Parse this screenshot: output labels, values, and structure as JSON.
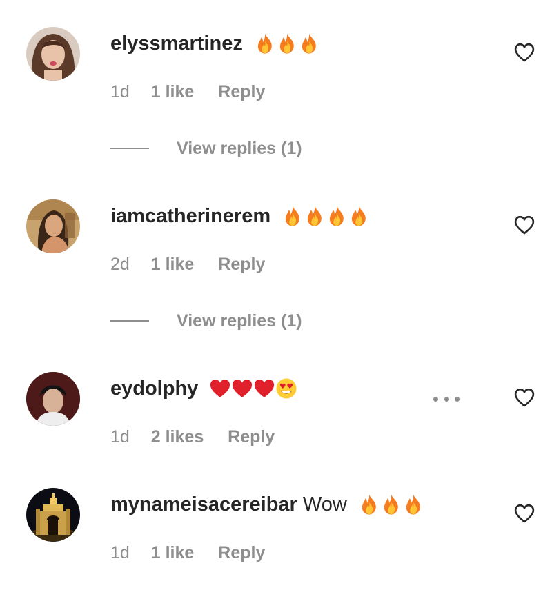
{
  "comments": [
    {
      "username": "elyssmartinez",
      "text": "",
      "emoji": [
        "fire-emoji",
        "fire-emoji",
        "fire-emoji"
      ],
      "time": "1d",
      "likes": "1 like",
      "reply_label": "Reply",
      "view_replies": "View replies (1)",
      "avatar": "profile-photo",
      "icon": "heart-outline-icon"
    },
    {
      "username": "iamcatherinerem",
      "text": "",
      "emoji": [
        "fire-emoji",
        "fire-emoji",
        "fire-emoji",
        "fire-emoji"
      ],
      "time": "2d",
      "likes": "1 like",
      "reply_label": "Reply",
      "view_replies": "View replies (1)",
      "avatar": "profile-photo",
      "icon": "heart-outline-icon"
    },
    {
      "username": "eydolphy",
      "text": "",
      "emoji": [
        "red-heart-emoji",
        "red-heart-emoji",
        "red-heart-emoji",
        "heart-eyes-emoji"
      ],
      "time": "1d",
      "likes": "2 likes",
      "reply_label": "Reply",
      "avatar": "profile-photo",
      "icon": "heart-outline-icon",
      "more_icon": "more-options-icon"
    },
    {
      "username": "mynameisacereibar",
      "text": "Wow",
      "emoji": [
        "fire-emoji",
        "fire-emoji",
        "fire-emoji"
      ],
      "time": "1d",
      "likes": "1 like",
      "reply_label": "Reply",
      "avatar": "profile-photo",
      "icon": "heart-outline-icon"
    }
  ],
  "colors": {
    "text": "#262626",
    "secondary": "#8e8e8e",
    "fire": "#f7931e",
    "heart_red": "#e02424",
    "emoji_yellow": "#ffcc33"
  }
}
